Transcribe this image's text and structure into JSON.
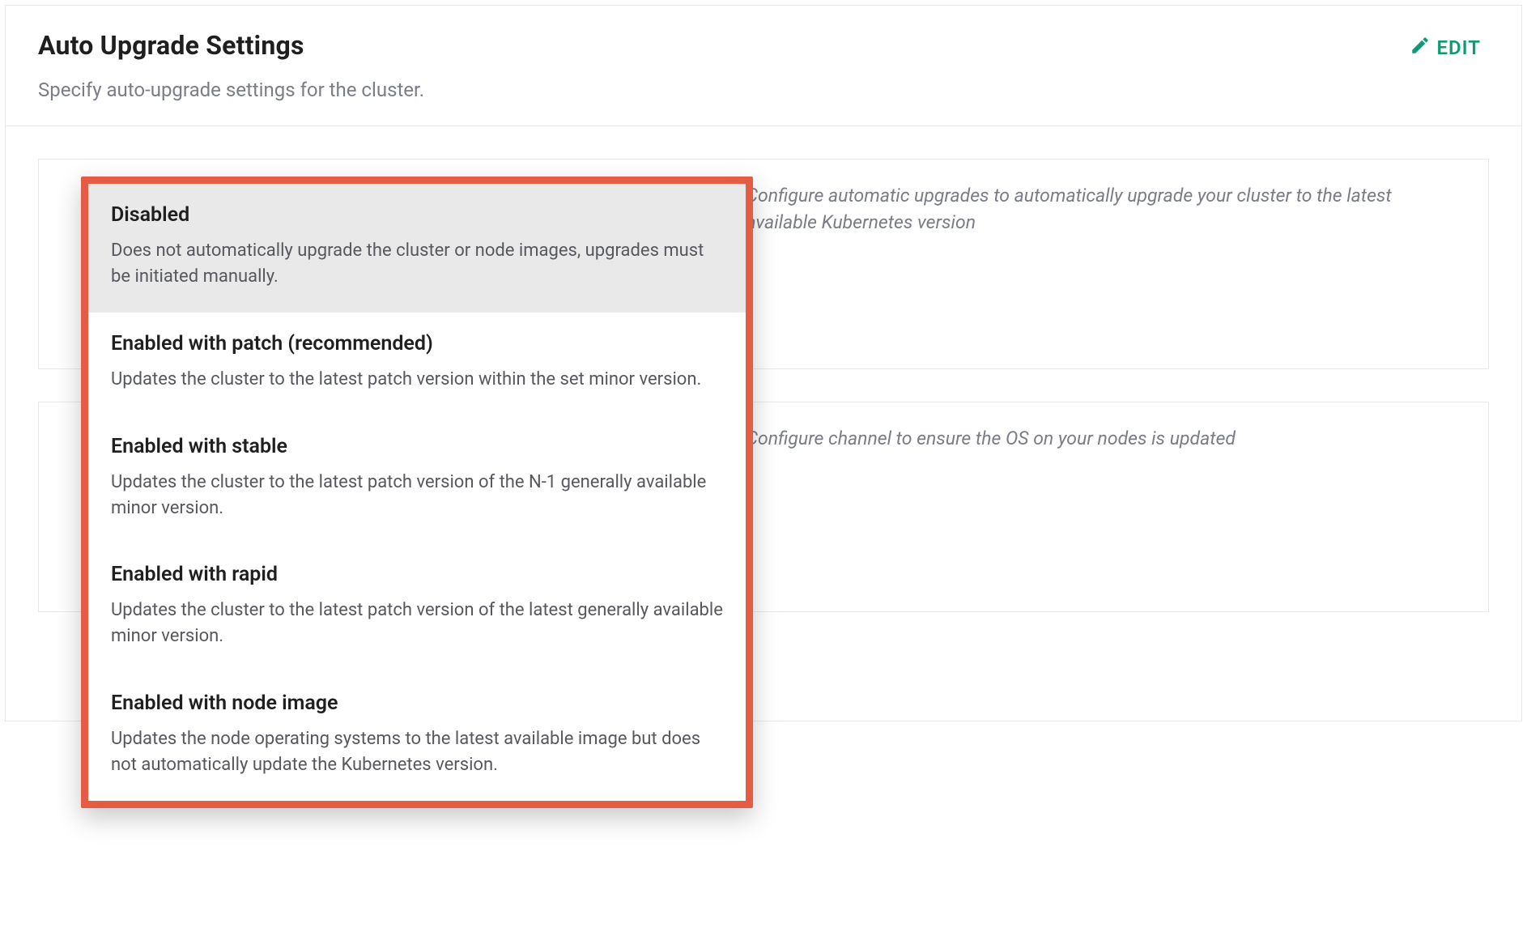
{
  "header": {
    "title": "Auto Upgrade Settings",
    "subtitle": "Specify auto-upgrade settings for the cluster.",
    "edit_label": "EDIT"
  },
  "settings": {
    "kubernetes_help": "Configure automatic upgrades to automatically upgrade your cluster to the latest available Kubernetes version",
    "os_help": "Configure channel to ensure the OS on your nodes is updated"
  },
  "dropdown": {
    "options": [
      {
        "title": "Disabled",
        "description": "Does not automatically upgrade the cluster or node images, upgrades must be initiated manually.",
        "selected": true
      },
      {
        "title": "Enabled with patch (recommended)",
        "description": "Updates the cluster to the latest patch version within the set minor version.",
        "selected": false
      },
      {
        "title": "Enabled with stable",
        "description": "Updates the cluster to the latest patch version of the N-1 generally available minor version.",
        "selected": false
      },
      {
        "title": "Enabled with rapid",
        "description": "Updates the cluster to the latest patch version of the latest generally available minor version.",
        "selected": false
      },
      {
        "title": "Enabled with node image",
        "description": "Updates the node operating systems to the latest available image but does not automatically update the Kubernetes version.",
        "selected": false
      }
    ]
  },
  "colors": {
    "accent": "#0e9b73",
    "highlight_border": "#e65b44"
  }
}
